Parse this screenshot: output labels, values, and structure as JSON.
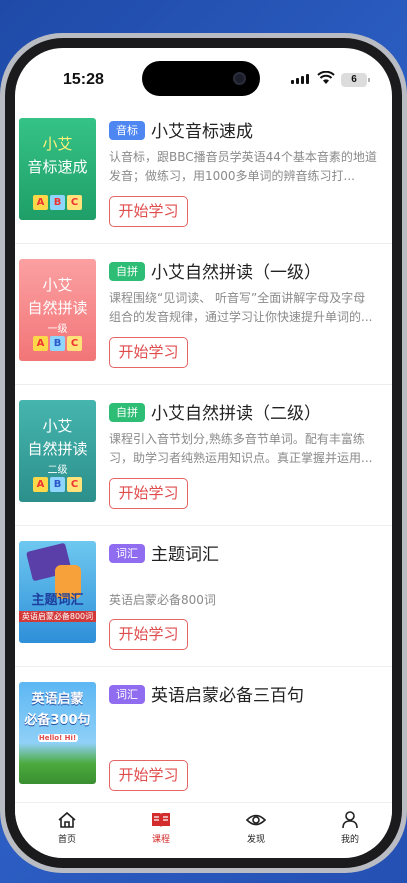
{
  "status_bar": {
    "time": "15:28",
    "battery": "6"
  },
  "courses": [
    {
      "badge": "音标",
      "badge_color": "#4e86f2",
      "title": "小艾音标速成",
      "description": "认音标，跟BBC播音员学英语44个基本音素的地道发音；做练习，用1000多单词的辨音练习打...",
      "button": "开始学习",
      "thumb": {
        "line1": "小艾",
        "line2": "音标速成",
        "line3": "",
        "blocks": [
          "A",
          "B",
          "C"
        ],
        "bg": "#2fb57d"
      }
    },
    {
      "badge": "自拼",
      "badge_color": "#2ebd74",
      "title": "小艾自然拼读（一级）",
      "description": "课程围绕“见词读、 听音写”全面讲解字母及字母组合的发音规律，通过学习让你快速提升单词的...",
      "button": "开始学习",
      "thumb": {
        "line1": "小艾",
        "line2": "自然拼读",
        "line3": "一级",
        "blocks": [
          "A",
          "B",
          "C"
        ],
        "bg": "#f48a8d"
      }
    },
    {
      "badge": "自拼",
      "badge_color": "#2ebd74",
      "title": "小艾自然拼读（二级）",
      "description": "课程引入音节划分,熟练多音节单词。配有丰富练习，助学习者纯熟运用知识点。真正掌握并运用...",
      "button": "开始学习",
      "thumb": {
        "line1": "小艾",
        "line2": "自然拼读",
        "line3": "二级",
        "blocks": [
          "A",
          "B",
          "C"
        ],
        "bg": "#36a19f"
      }
    },
    {
      "badge": "词汇",
      "badge_color": "#8f6cf0",
      "title": "主题词汇",
      "description": "英语启蒙必备800词",
      "button": "开始学习",
      "thumb": {
        "line1": "主题词汇",
        "line2": "英语启蒙必备800词",
        "line3": "",
        "blocks": [],
        "bg": "#3aa6e6"
      }
    },
    {
      "badge": "词汇",
      "badge_color": "#8f6cf0",
      "title": "英语启蒙必备三百句",
      "description": "",
      "button": "开始学习",
      "thumb": {
        "line1": "英语启蒙",
        "line2": "必备300句",
        "line3": "Hello! Hi!",
        "blocks": [],
        "bg": "#3f9de0"
      }
    }
  ],
  "tabs": [
    {
      "label": "首页",
      "icon": "home-icon",
      "active": false
    },
    {
      "label": "课程",
      "icon": "book-icon",
      "active": true
    },
    {
      "label": "发现",
      "icon": "eye-icon",
      "active": false
    },
    {
      "label": "我的",
      "icon": "person-icon",
      "active": false
    }
  ],
  "colors": {
    "accent": "#d22c2c",
    "button_border": "#e56464"
  }
}
